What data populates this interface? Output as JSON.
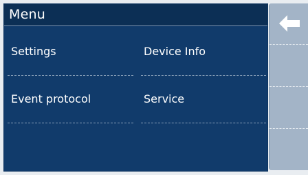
{
  "menu": {
    "title": "Menu",
    "items": [
      {
        "label": "Settings"
      },
      {
        "label": "Device Info"
      },
      {
        "label": "Event protocol"
      },
      {
        "label": "Service"
      }
    ]
  },
  "sidebar": {
    "back_icon": "arrow-left-icon"
  },
  "colors": {
    "panel_background": "#113b6b",
    "header_background": "#0c2f55",
    "sidebar_background": "#a3b4c7",
    "text": "#ffffff"
  }
}
